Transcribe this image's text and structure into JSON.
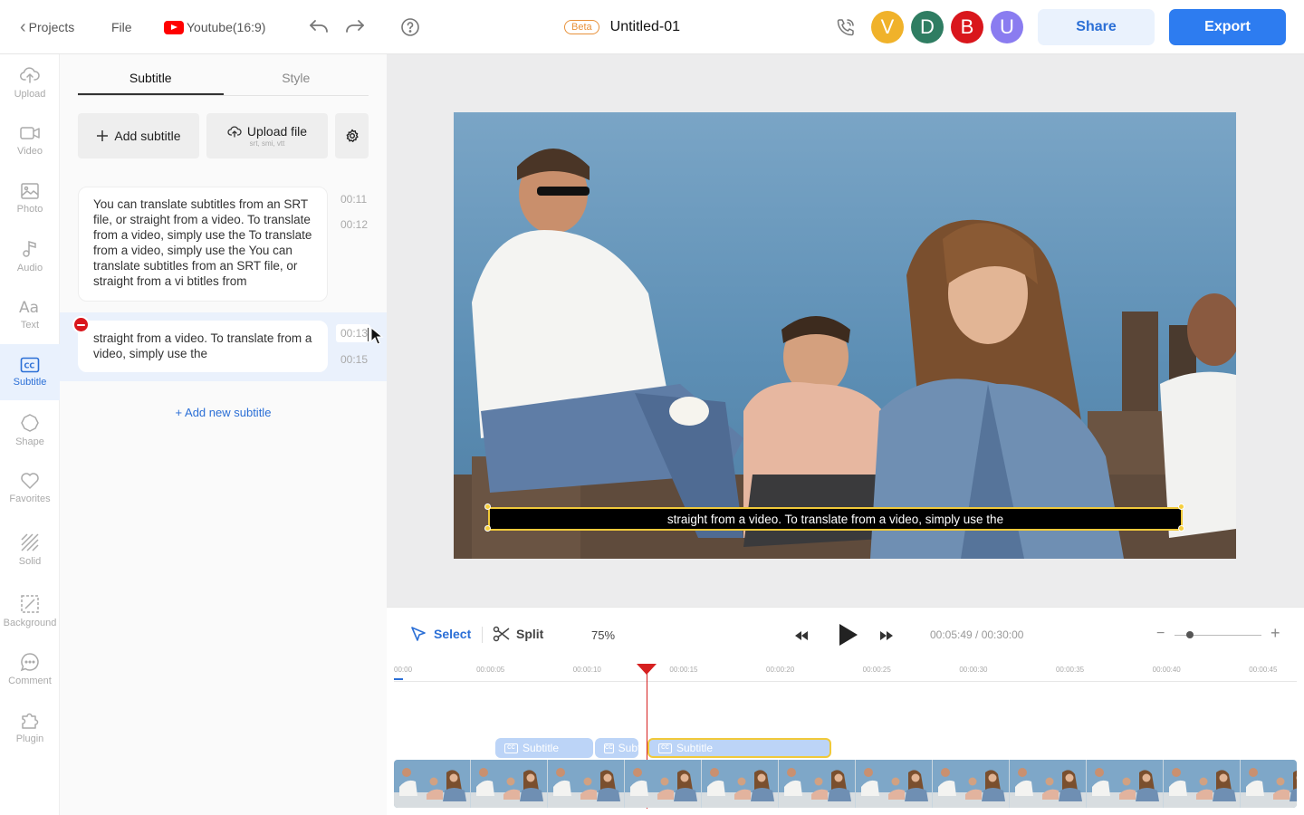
{
  "header": {
    "back_label": "Projects",
    "file_label": "File",
    "format_label": "Youtube(16:9)",
    "beta_label": "Beta",
    "doc_title": "Untitled-01",
    "avatars": [
      {
        "letter": "V",
        "color": "#f0b22a"
      },
      {
        "letter": "D",
        "color": "#2f7d62"
      },
      {
        "letter": "B",
        "color": "#d9161c"
      },
      {
        "letter": "U",
        "color": "#8a7cf0"
      }
    ],
    "share_label": "Share",
    "export_label": "Export"
  },
  "rail": {
    "items": [
      {
        "label": "Upload",
        "icon": "upload-cloud-icon"
      },
      {
        "label": "Video",
        "icon": "video-camera-icon"
      },
      {
        "label": "Photo",
        "icon": "photo-icon"
      },
      {
        "label": "Audio",
        "icon": "music-note-icon"
      },
      {
        "label": "Text",
        "icon": "text-aa-icon"
      },
      {
        "label": "Subtitle",
        "icon": "closed-caption-icon"
      },
      {
        "label": "Shape",
        "icon": "shape-icon"
      },
      {
        "label": "Favorites",
        "icon": "heart-icon"
      },
      {
        "label": "Solid",
        "icon": "solid-hatch-icon"
      },
      {
        "label": "Background",
        "icon": "background-icon"
      },
      {
        "label": "Comment",
        "icon": "comment-icon"
      },
      {
        "label": "Plugin",
        "icon": "puzzle-icon"
      }
    ],
    "active": "Subtitle"
  },
  "panel": {
    "tabs": [
      "Subtitle",
      "Style"
    ],
    "active_tab": "Subtitle",
    "add_subtitle_label": "Add subtitle",
    "upload_label": "Upload file",
    "upload_hint": "srt, smi, vtt",
    "subtitles": [
      {
        "text": "You can translate subtitles from an SRT file, or straight from a video. To translate from a video, simply use the To translate from a video, simply use the You can translate subtitles from an SRT file, or straight from a vi btitles from",
        "start": "00:11",
        "end": "00:12"
      },
      {
        "text": "straight from a video. To translate from a video, simply use the",
        "start": "00:13",
        "end": "00:15"
      }
    ],
    "add_new_label": "+ Add new subtitle"
  },
  "canvas": {
    "caption_text": "straight from a video. To translate from a video, simply use the"
  },
  "timeline": {
    "select_label": "Select",
    "split_label": "Split",
    "zoom_label": "75%",
    "time_readout": "00:05:49 / 00:30:00",
    "ticks": [
      "00:00",
      "00:00:05",
      "00:00:10",
      "00:00:15",
      "00:00:20",
      "00:00:25",
      "00:00:30",
      "00:00:35",
      "00:00:40",
      "00:00:45"
    ],
    "clips": [
      {
        "label": "Subtitle",
        "selected": false
      },
      {
        "label": "Subtitle",
        "selected": false
      },
      {
        "label": "Subtitle",
        "selected": true
      }
    ],
    "playhead_seconds": 13.1,
    "zoom_level": 0.18
  },
  "colors": {
    "accent": "#2d7cf0",
    "selection_yellow": "#f0c93a",
    "playhead": "#d62020"
  }
}
